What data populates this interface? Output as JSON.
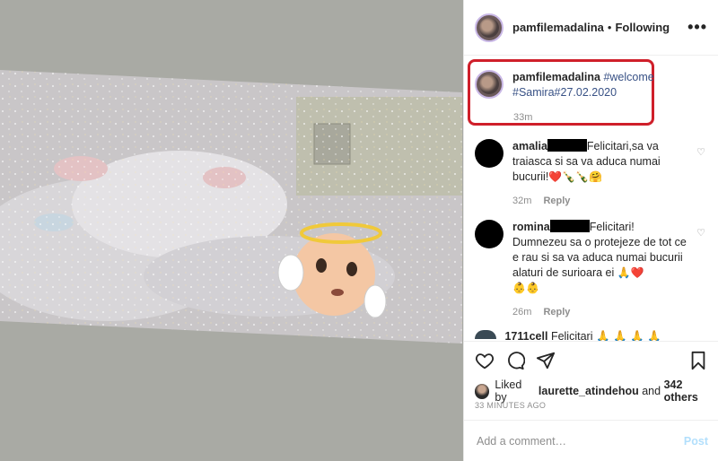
{
  "header": {
    "username": "pamfilemadalina",
    "separator": "•",
    "follow_label": "Following",
    "more": "•••"
  },
  "caption": {
    "username": "pamfilemadalina",
    "line1_tag": "#welcome",
    "line2": "#Samira#27.02.2020",
    "time": "33m"
  },
  "comments": [
    {
      "username": "amalia",
      "text": "Felicitari,sa va traiasca si sa va aduca numai bucurii!",
      "emoji": "❤️🍾🍾🤗",
      "time": "32m",
      "reply_label": "Reply"
    },
    {
      "username": "romina",
      "text": "Felicitari! Dumnezeu sa o protejeze de tot ce e rau si sa va aduca numai bucurii alaturi de surioara ei",
      "emoji": "🙏❤️",
      "emoji2": "👶👶",
      "time": "26m",
      "reply_label": "Reply"
    }
  ],
  "partial_comment": {
    "username": "1711cell",
    "text": "Felicitari 🙏 🙏 🙏 🙏"
  },
  "likes": {
    "prefix": "Liked by",
    "user": "laurette_atindehou",
    "connector": "and",
    "count": "342 others"
  },
  "timestamp": "33 MINUTES AGO",
  "add_comment": {
    "placeholder": "Add a comment…",
    "post_label": "Post"
  },
  "icons": [
    "heart-icon",
    "comment-icon",
    "share-icon",
    "bookmark-icon",
    "more-icon"
  ],
  "colors": {
    "highlight_border": "#cf1f2a",
    "hashtag": "#385185",
    "post_button": "#b2dffc",
    "photo_background": "#a9aaa4"
  }
}
